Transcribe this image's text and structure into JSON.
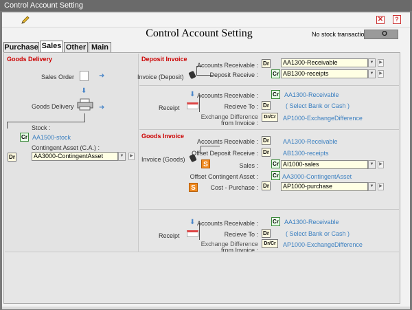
{
  "window": {
    "title": "Control Account Setting"
  },
  "toolbar": {
    "edit_icon": "pencil-icon",
    "close_icon": "close-icon",
    "help_icon": "help-icon",
    "close_glyph": "✕",
    "help_glyph": "?"
  },
  "header": {
    "title": "Control Account Setting",
    "no_stock_label": "No stock transaction",
    "no_stock_value": "O"
  },
  "tabs": [
    {
      "label": "Purchase"
    },
    {
      "label": "Sales",
      "active": true
    },
    {
      "label": "Other"
    },
    {
      "label": "Main"
    }
  ],
  "goods_delivery": {
    "title": "Goods Delivery",
    "sales_order": "Sales Order",
    "goods_delivery": "Goods Delivery",
    "stock_label": "Stock :",
    "stock_badge": "Cr",
    "stock_account": "AA1500-stock",
    "contingent_label": "Contingent Asset (C.A.) :",
    "contingent_badge": "Dr",
    "contingent_account": "AA3000-ContingentAsset"
  },
  "deposit_invoice": {
    "title": "Deposit Invoice",
    "invoice_label": "Invoice (Deposit)",
    "ar_label": "Accounts Receivable :",
    "ar_badge": "Dr",
    "ar_account": "AA1300-Receivable",
    "deposit_label": "Deposit Receive :",
    "deposit_badge": "Cr",
    "deposit_account": "AB1300-receipts",
    "receipt_label": "Receipt",
    "r_ar_label": "Accounts Receivable :",
    "r_ar_badge": "Cr",
    "r_ar_account": "AA1300-Receivable",
    "r_to_label": "Recieve To :",
    "r_to_badge": "Dr",
    "r_to_value": "( Select Bank or Cash )",
    "r_ex_label": "Exchange Difference",
    "r_ex_label2": "from Invoice :",
    "r_ex_badge": "Dr/Cr",
    "r_ex_account": "AP1000-ExchangeDifference"
  },
  "goods_invoice": {
    "title": "Goods Invoice",
    "invoice_label": "Invoice (Goods)",
    "ar_label": "Accounts Receivable :",
    "ar_badge": "Dr",
    "ar_account": "AA1300-Receivable",
    "offset_dep_label": "Offset Deposit Receive :",
    "offset_dep_badge": "Dr",
    "offset_dep_account": "AB1300-receipts",
    "sales_label": "Sales :",
    "sales_badge": "Cr",
    "sales_account": "AI1000-sales",
    "offset_ca_label": "Offset Contingent Asset :",
    "offset_ca_badge": "Cr",
    "offset_ca_account": "AA3000-ContingentAsset",
    "cost_label": "Cost - Purchase :",
    "cost_badge": "Dr",
    "cost_account": "AP1000-purchase",
    "s_glyph": "S",
    "receipt_label": "Receipt",
    "r_ar_label": "Accounts Receivable :",
    "r_ar_badge": "Cr",
    "r_ar_account": "AA1300-Receivable",
    "r_to_label": "Recieve To :",
    "r_to_badge": "Dr",
    "r_to_value": "( Select Bank or Cash )",
    "r_ex_label": "Exchange Difference",
    "r_ex_label2": "from Invoice :",
    "r_ex_badge": "Dr/Cr",
    "r_ex_account": "AP1000-ExchangeDifference"
  },
  "controls": {
    "dropdown_glyph": "▼",
    "nav_glyph": "▶",
    "arrow_right": "➜",
    "arrow_down": "⬇"
  }
}
